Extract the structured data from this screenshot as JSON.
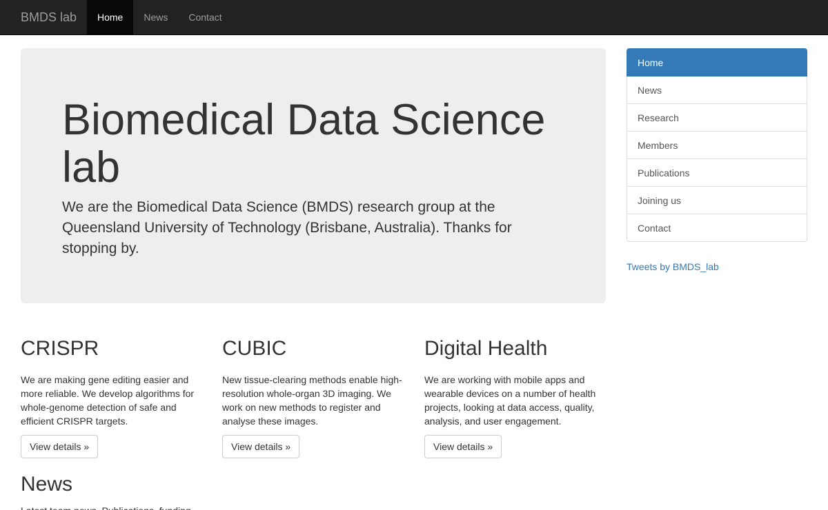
{
  "navbar": {
    "brand": "BMDS lab",
    "items": [
      {
        "label": "Home",
        "active": true
      },
      {
        "label": "News",
        "active": false
      },
      {
        "label": "Contact",
        "active": false
      }
    ]
  },
  "jumbotron": {
    "title": "Biomedical Data Science lab",
    "lead": "We are the Biomedical Data Science (BMDS) research group at the Queensland University of Technology (Brisbane, Australia). Thanks for stopping by."
  },
  "columns": [
    {
      "title": "CRISPR",
      "text": "We are making gene editing easier and more reliable. We develop algorithms for whole-genome detection of safe and efficient CRISPR targets.",
      "button": "View details »"
    },
    {
      "title": "CUBIC",
      "text": "New tissue-clearing methods enable high-resolution whole-organ 3D imaging. We work on new methods to register and analyse these images.",
      "button": "View details »"
    },
    {
      "title": "Digital Health",
      "text": "We are working with mobile apps and wearable devices on a number of health projects, looking at data access, quality, analysis, and user engagement.",
      "button": "View details »"
    }
  ],
  "news": {
    "title": "News",
    "text": "Latest team news. Publications, funding"
  },
  "sidebar": {
    "items": [
      {
        "label": "Home",
        "active": true
      },
      {
        "label": "News",
        "active": false
      },
      {
        "label": "Research",
        "active": false
      },
      {
        "label": "Members",
        "active": false
      },
      {
        "label": "Publications",
        "active": false
      },
      {
        "label": "Joining us",
        "active": false
      },
      {
        "label": "Contact",
        "active": false
      }
    ],
    "tweets_link": "Tweets by BMDS_lab"
  },
  "colors": {
    "navbar_bg": "#222222",
    "accent": "#337ab7",
    "jumbotron_bg": "#eeeeee"
  }
}
